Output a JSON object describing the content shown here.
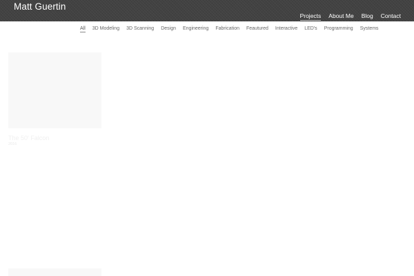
{
  "header": {
    "site_title": "Matt Guertin",
    "background_color": "#424242",
    "nav": [
      {
        "label": "Projects",
        "active": true
      },
      {
        "label": "About Me",
        "active": false
      },
      {
        "label": "Blog",
        "active": false
      },
      {
        "label": "Contact",
        "active": false
      }
    ]
  },
  "filters": [
    {
      "label": "All",
      "active": true
    },
    {
      "label": "3D Modeling",
      "active": false
    },
    {
      "label": "3D Scanning",
      "active": false
    },
    {
      "label": "Design",
      "active": false
    },
    {
      "label": "Engineering",
      "active": false
    },
    {
      "label": "Fabrication",
      "active": false
    },
    {
      "label": "Feautured",
      "active": false
    },
    {
      "label": "Interactive",
      "active": false
    },
    {
      "label": "LED's",
      "active": false
    },
    {
      "label": "Programming",
      "active": false
    },
    {
      "label": "Systems",
      "active": false
    }
  ],
  "projects": [
    {
      "title": "The 50' Falcon",
      "year": "2016"
    }
  ]
}
